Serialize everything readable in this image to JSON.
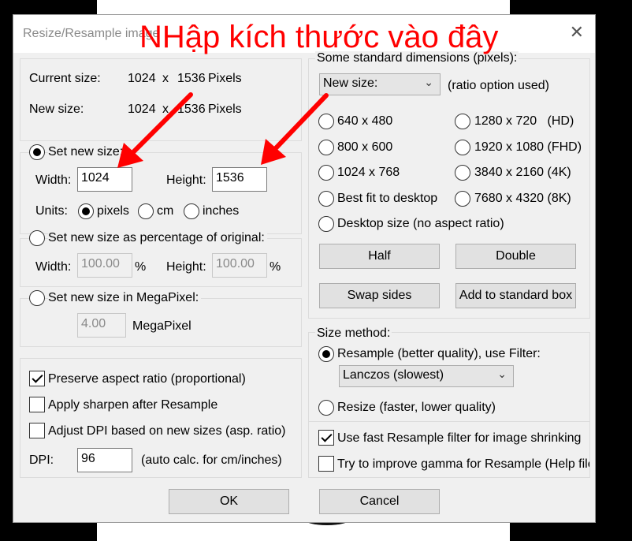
{
  "dialog": {
    "title": "Resize/Resample image",
    "close_glyph": "✕",
    "annotation": "NHập kích thước vào đây"
  },
  "current": {
    "label": "Current size:",
    "width": "1024",
    "x": "x",
    "height": "1536",
    "unit": "Pixels"
  },
  "newsize": {
    "label": "New size:",
    "width": "1024",
    "x": "x",
    "height": "1536",
    "unit": "Pixels"
  },
  "set_new": {
    "label": "Set new size:",
    "width_label": "Width:",
    "width_value": "1024",
    "height_label": "Height:",
    "height_value": "1536",
    "units_label": "Units:",
    "units": [
      "pixels",
      "cm",
      "inches"
    ]
  },
  "percent": {
    "label": "Set new size as percentage of original:",
    "width_label": "Width:",
    "width_value": "100.00",
    "pct": "%",
    "height_label": "Height:",
    "height_value": "100.00"
  },
  "mega": {
    "label": "Set new size in MegaPixel:",
    "value": "4.00",
    "unit": "MegaPixel"
  },
  "options": {
    "preserve": "Preserve aspect ratio (proportional)",
    "sharpen": "Apply sharpen after Resample",
    "dpi_adjust": "Adjust DPI based on new sizes (asp. ratio)",
    "dpi_label": "DPI:",
    "dpi_value": "96",
    "dpi_note": "(auto calc. for cm/inches)"
  },
  "standard": {
    "label": "Some standard dimensions (pixels):",
    "dropdown": "New size:",
    "ratio_note": "(ratio option used)",
    "left": [
      "640 x 480",
      "800 x 600",
      "1024 x 768",
      "Best fit to desktop"
    ],
    "right": [
      "1280 x 720   (HD)",
      "1920 x 1080 (FHD)",
      "3840 x 2160 (4K)",
      "7680 x 4320 (8K)"
    ],
    "desktop": "Desktop size (no aspect ratio)",
    "half": "Half",
    "double": "Double",
    "swap": "Swap sides",
    "add": "Add to standard box"
  },
  "method": {
    "label": "Size method:",
    "resample": "Resample (better quality), use Filter:",
    "filter": "Lanczos (slowest)",
    "resize": "Resize (faster, lower quality)",
    "fast": "Use fast Resample filter for image shrinking",
    "gamma": "Try to improve gamma for Resample (Help file"
  },
  "footer": {
    "ok": "OK",
    "cancel": "Cancel"
  },
  "colors": {
    "annotation": "#ff0000",
    "dialog_bg": "#f0f0f0"
  }
}
